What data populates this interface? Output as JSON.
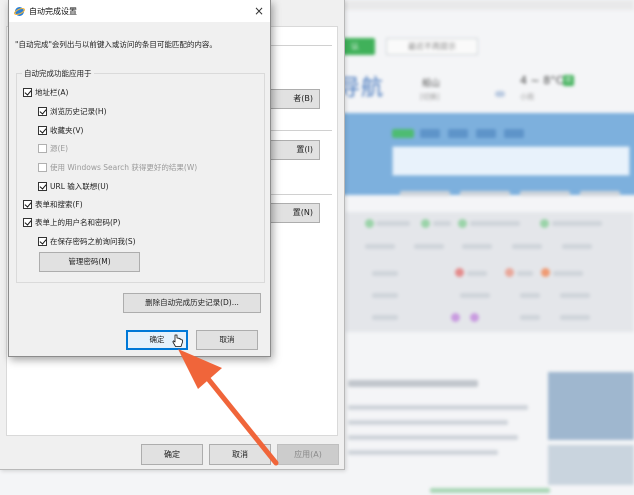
{
  "background_page": {
    "confirm_label": "认",
    "not_remind_label": "最近不再提示",
    "logo_text": "导航",
    "city": "船山",
    "city_switch": "[切换]",
    "temperature": "4 ~ 8°C",
    "aqi": "优",
    "weather": "小雨"
  },
  "parent_dialog": {
    "side_buttons": [
      "者(B)",
      "置(I)",
      "置(N)"
    ],
    "ok": "确定",
    "cancel": "取消",
    "apply": "应用(A)"
  },
  "autocomplete_dialog": {
    "title": "自动完成设置",
    "close": "×",
    "description": "\"自动完成\"会列出与以前键入或访问的条目可能匹配的内容。",
    "group_label": "自动完成功能应用于",
    "options": [
      {
        "label": "地址栏(A)",
        "checked": true,
        "enabled": true
      },
      {
        "label": "浏览历史记录(H)",
        "checked": true,
        "enabled": true
      },
      {
        "label": "收藏夹(V)",
        "checked": true,
        "enabled": true
      },
      {
        "label": "源(E)",
        "checked": false,
        "enabled": false
      },
      {
        "label": "使用 Windows Search 获得更好的结果(W)",
        "checked": false,
        "enabled": false
      },
      {
        "label": "URL 输入联想(U)",
        "checked": true,
        "enabled": true
      },
      {
        "label": "表单和搜索(F)",
        "checked": true,
        "enabled": true
      },
      {
        "label": "表单上的用户名和密码(P)",
        "checked": true,
        "enabled": true
      },
      {
        "label": "在保存密码之前询问我(S)",
        "checked": true,
        "enabled": true
      }
    ],
    "manage_passwords": "管理密码(M)",
    "delete_history": "删除自动完成历史记录(D)...",
    "ok": "确定",
    "cancel": "取消"
  },
  "colors": {
    "arrow": "#f0653a",
    "accent_blue": "#0078d7",
    "green": "#40b15a"
  }
}
